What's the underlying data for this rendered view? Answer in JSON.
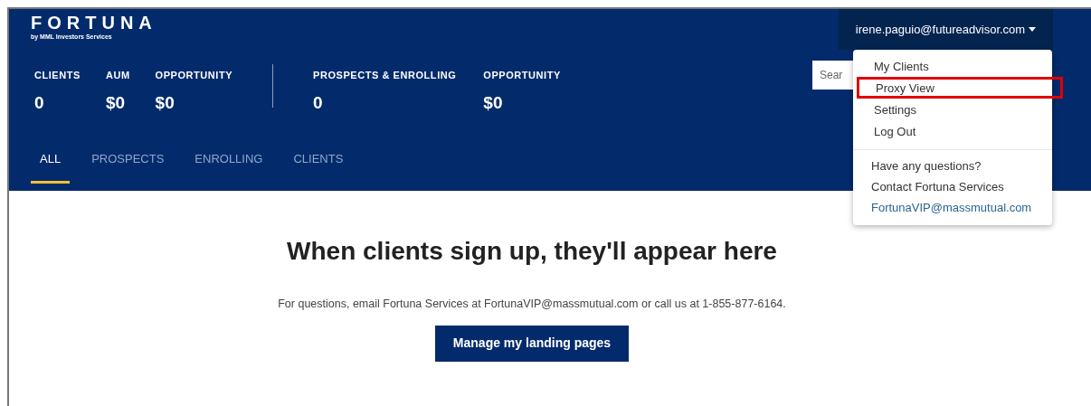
{
  "logo": {
    "name": "FORTUNA",
    "tagline": "by MML Investors Services"
  },
  "stats_left": [
    {
      "label": "CLIENTS",
      "value": "0"
    },
    {
      "label": "AUM",
      "value": "$0"
    },
    {
      "label": "OPPORTUNITY",
      "value": "$0"
    }
  ],
  "stats_right": [
    {
      "label": "PROSPECTS & ENROLLING",
      "value": "0"
    },
    {
      "label": "OPPORTUNITY",
      "value": "$0"
    }
  ],
  "tabs": [
    {
      "label": "ALL",
      "selected": true
    },
    {
      "label": "PROSPECTS",
      "selected": false
    },
    {
      "label": "ENROLLING",
      "selected": false
    },
    {
      "label": "CLIENTS",
      "selected": false
    }
  ],
  "search": {
    "placeholder": "Sear"
  },
  "account": {
    "email": "irene.paguio@futureadvisor.com",
    "expanded": true
  },
  "menu": {
    "items": [
      {
        "label": "My Clients",
        "highlighted": false
      },
      {
        "label": "Proxy View",
        "highlighted": true
      },
      {
        "label": "Settings",
        "highlighted": false
      },
      {
        "label": "Log Out",
        "highlighted": false
      }
    ],
    "help": [
      {
        "kind": "text",
        "label": "Have any questions?"
      },
      {
        "kind": "text",
        "label": "Contact Fortuna Services"
      },
      {
        "kind": "link",
        "label": "FortunaVIP@massmutual.com"
      }
    ]
  },
  "empty_state": {
    "heading": "When clients sign up, they'll appear here",
    "message": "For questions, email Fortuna Services at FortunaVIP@massmutual.com or call us at 1-855-877-6164.",
    "button": "Manage my landing pages"
  }
}
